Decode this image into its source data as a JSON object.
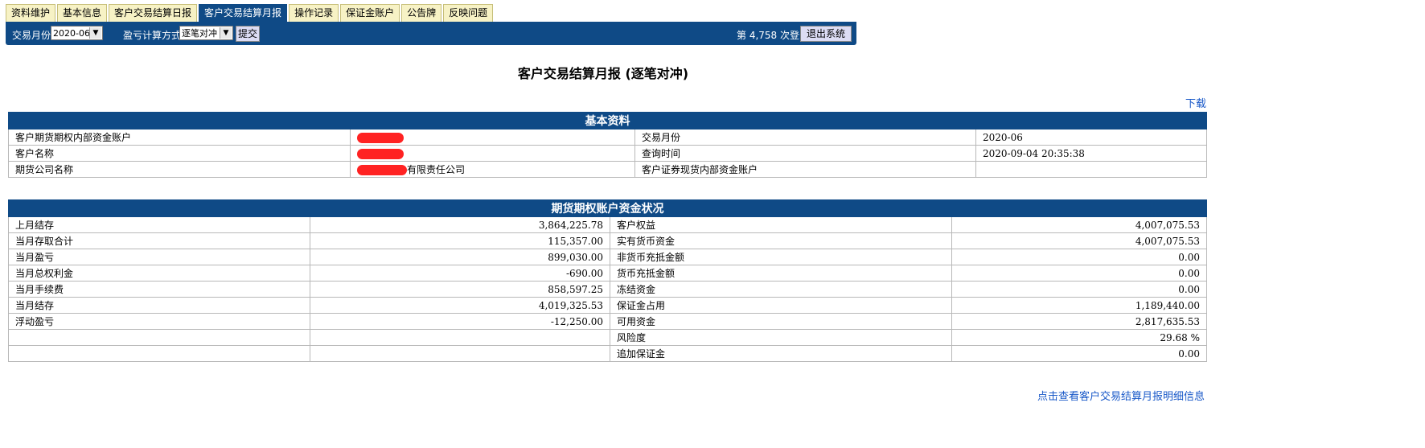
{
  "tabs": [
    "资料维护",
    "基本信息",
    "客户交易结算日报",
    "客户交易结算月报",
    "操作记录",
    "保证金账户",
    "公告牌",
    "反映问题"
  ],
  "toolbar": {
    "month_label": "交易月份",
    "month_value": "2020-06",
    "method_label": "盈亏计算方式",
    "method_value": "逐笔对冲",
    "submit_label": "提交",
    "login_text": "第 4,758 次登录",
    "logout_label": "退出系统"
  },
  "page_title": "客户交易结算月报 (逐笔对冲)",
  "download_label": "下载",
  "basic_info": {
    "header": "基本资料",
    "rows": [
      {
        "l1": "客户期货期权内部资金账户",
        "v1": "",
        "l2": "交易月份",
        "v2": "2020-06"
      },
      {
        "l1": "客户名称",
        "v1": "",
        "l2": "查询时间",
        "v2": "2020-09-04 20:35:38"
      },
      {
        "l1": "期货公司名称",
        "v1": "有限责任公司",
        "l2": "客户证券现货内部资金账户",
        "v2": ""
      }
    ]
  },
  "funds": {
    "header": "期货期权账户资金状况",
    "rows": [
      {
        "l1": "上月结存",
        "v1": "3,864,225.78",
        "l2": "客户权益",
        "v2": "4,007,075.53"
      },
      {
        "l1": "当月存取合计",
        "v1": "115,357.00",
        "l2": "实有货币资金",
        "v2": "4,007,075.53"
      },
      {
        "l1": "当月盈亏",
        "v1": "899,030.00",
        "l2": "非货币充抵金额",
        "v2": "0.00"
      },
      {
        "l1": "当月总权利金",
        "v1": "-690.00",
        "l2": "货币充抵金额",
        "v2": "0.00"
      },
      {
        "l1": "当月手续费",
        "v1": "858,597.25",
        "l2": "冻结资金",
        "v2": "0.00"
      },
      {
        "l1": "当月结存",
        "v1": "4,019,325.53",
        "l2": "保证金占用",
        "v2": "1,189,440.00"
      },
      {
        "l1": "浮动盈亏",
        "v1": "-12,250.00",
        "l2": "可用资金",
        "v2": "2,817,635.53"
      },
      {
        "l1": "",
        "v1": "",
        "l2": "风险度",
        "v2": "29.68 %"
      },
      {
        "l1": "",
        "v1": "",
        "l2": "追加保证金",
        "v2": "0.00"
      }
    ]
  },
  "detail_link": "点击查看客户交易结算月报明细信息"
}
